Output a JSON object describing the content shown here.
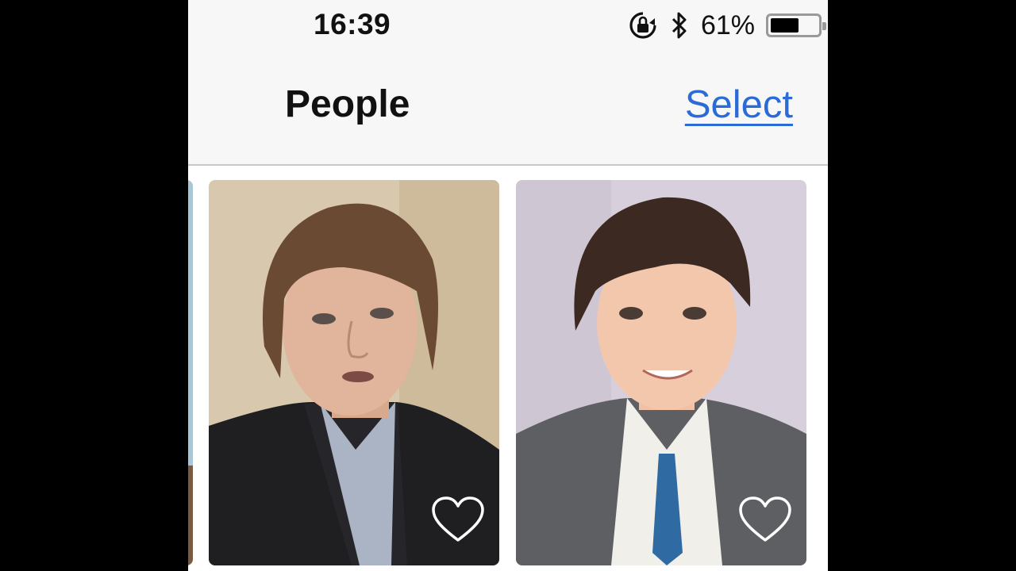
{
  "status_bar": {
    "time": "16:39",
    "battery_percent_label": "61%",
    "battery_level": 0.61,
    "icons": [
      "rotation-lock-icon",
      "bluetooth-icon",
      "battery-icon"
    ]
  },
  "nav": {
    "title": "People",
    "select_label": "Select",
    "accent_color": "#2a6bd6"
  },
  "people": [
    {
      "photo": "partial-person-photo",
      "favorite_icon": "heart-outline-icon"
    },
    {
      "photo": "older-man-photo",
      "favorite_icon": "heart-outline-icon"
    },
    {
      "photo": "young-man-photo",
      "favorite_icon": "heart-outline-icon"
    }
  ]
}
